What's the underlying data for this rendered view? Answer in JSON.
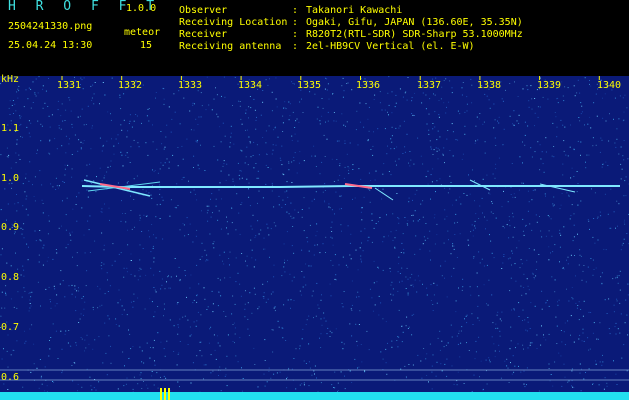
{
  "header": {
    "app_title": "H R O F F T",
    "version": "1.0.0",
    "filename": "2504241330.png",
    "datetime": "25.04.24 13:30",
    "detection_label": "meteor",
    "detection_count": "15",
    "info": [
      {
        "label": "Observer",
        "value": "Takanori Kawachi"
      },
      {
        "label": "Receiving Location",
        "value": "Ogaki, Gifu, JAPAN (136.60E, 35.35N)"
      },
      {
        "label": "Receiver",
        "value": "R820T2(RTL-SDR) SDR-Sharp 53.1000MHz"
      },
      {
        "label": "Receiving antenna",
        "value": "2el-HB9CV Vertical (el. E-W)"
      }
    ],
    "separator": ":"
  },
  "spectrogram": {
    "y_unit": "kHz",
    "y_ticks": [
      "1.1",
      "1.0",
      "0.9",
      "0.8",
      "0.7",
      "0.6"
    ],
    "x_ticks": [
      "1331",
      "1332",
      "1333",
      "1334",
      "1335",
      "1336",
      "1337",
      "1338",
      "1339",
      "1340"
    ],
    "colors": {
      "background": "#0a1a78",
      "noise": "#3aa0e8",
      "carrier": "#7fe8ff",
      "baseline": "#22e0f0",
      "label": "#ffff00"
    }
  }
}
